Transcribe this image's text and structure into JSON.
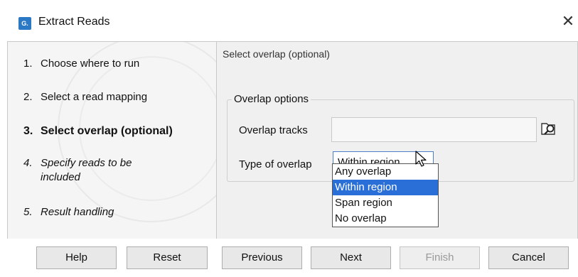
{
  "window": {
    "title": "Extract Reads",
    "app_icon_text": "G.",
    "close_glyph": "✕"
  },
  "steps": [
    {
      "num": "1.",
      "label": "Choose where to run"
    },
    {
      "num": "2.",
      "label": "Select a read mapping"
    },
    {
      "num": "3.",
      "label": "Select overlap (optional)"
    },
    {
      "num": "4.",
      "label": "Specify reads to be included"
    },
    {
      "num": "5.",
      "label": "Result handling"
    }
  ],
  "panel": {
    "title": "Select overlap (optional)",
    "group_label": "Overlap options",
    "overlap_tracks_label": "Overlap tracks",
    "overlap_tracks_value": "",
    "type_of_overlap_label": "Type of overlap",
    "type_of_overlap_value": "Within region"
  },
  "dropdown_options": [
    "Any overlap",
    "Within region",
    "Span region",
    "No overlap"
  ],
  "buttons": {
    "help": "Help",
    "reset": "Reset",
    "previous": "Previous",
    "next": "Next",
    "finish": "Finish",
    "cancel": "Cancel"
  },
  "colors": {
    "accent": "#2a6ed8",
    "app_icon": "#2b78c5"
  }
}
